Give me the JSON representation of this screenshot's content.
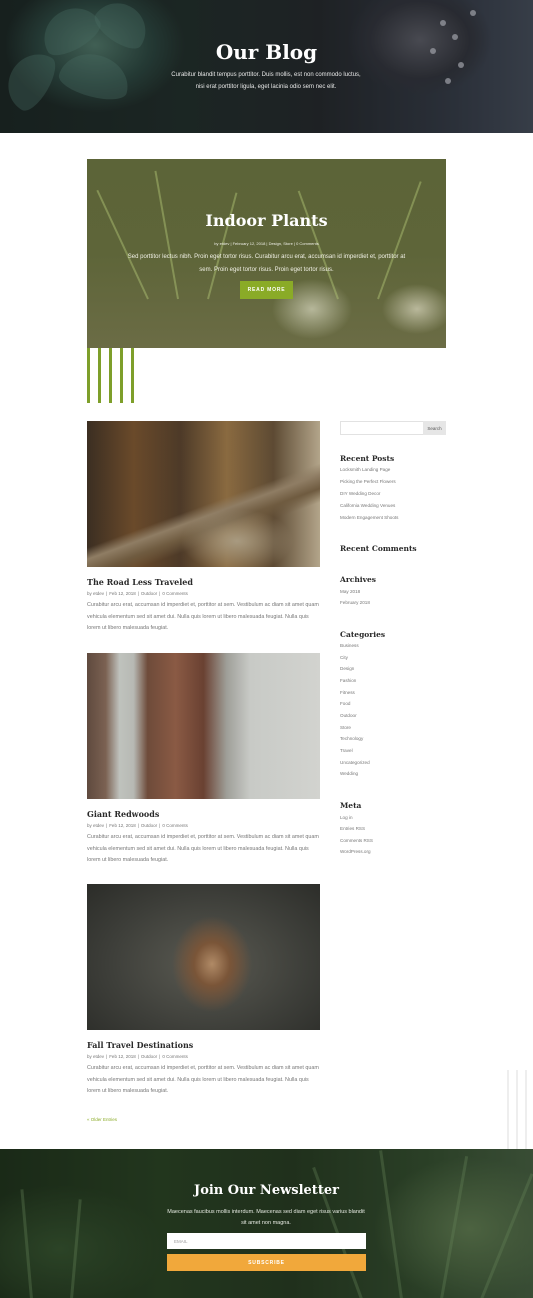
{
  "hero": {
    "title": "Our Blog",
    "subtitle": "Curabitur blandit tempus porttitor. Duis mollis, est non commodo luctus, nisi erat porttitor ligula, eget lacinia odio sem nec elit."
  },
  "featured": {
    "title": "Indoor Plants",
    "meta": "by etdev | February 12, 2018 | Design, Store | 0 Comments",
    "excerpt": "Sed porttitor lectus nibh. Proin eget tortor risus. Curabitur arcu erat, accumsan id imperdiet et, porttitor at sem. Proin eget tortor risus. Proin eget tortor risus.",
    "button_label": "READ MORE"
  },
  "posts": [
    {
      "title": "The Road Less Traveled",
      "author": "by etdev",
      "date": "Feb 12, 2018",
      "category": "Outdoor",
      "comments": "0 Comments",
      "excerpt": "Curabitur arcu erat, accumsan id imperdiet et, porttitor at sem. Vestibulum ac diam sit amet quam vehicula elementum sed sit amet dui. Nulla quis lorem ut libero malesuada feugiat. Nulla quis lorem ut libero malesuada feugiat."
    },
    {
      "title": "Giant Redwoods",
      "author": "by etdev",
      "date": "Feb 12, 2018",
      "category": "Outdoor",
      "comments": "0 Comments",
      "excerpt": "Curabitur arcu erat, accumsan id imperdiet et, porttitor at sem. Vestibulum ac diam sit amet quam vehicula elementum sed sit amet dui. Nulla quis lorem ut libero malesuada feugiat. Nulla quis lorem ut libero malesuada feugiat."
    },
    {
      "title": "Fall Travel Destinations",
      "author": "by etdev",
      "date": "Feb 12, 2018",
      "category": "Outdoor",
      "comments": "0 Comments",
      "excerpt": "Curabitur arcu erat, accumsan id imperdiet et, porttitor at sem. Vestibulum ac diam sit amet quam vehicula elementum sed sit amet dui. Nulla quis lorem ut libero malesuada feugiat. Nulla quis lorem ut libero malesuada feugiat."
    }
  ],
  "pagination": {
    "older_label": "« Older Entries"
  },
  "sidebar": {
    "search": {
      "placeholder": "",
      "button_label": "Search"
    },
    "recent_posts": {
      "title": "Recent Posts",
      "items": [
        "Locksmith Landing Page",
        "Picking the Perfect Flowers",
        "DIY Wedding Decor",
        "California Wedding Venues",
        "Modern Engagement Shoots"
      ]
    },
    "recent_comments": {
      "title": "Recent Comments"
    },
    "archives": {
      "title": "Archives",
      "items": [
        "May 2018",
        "February 2018"
      ]
    },
    "categories": {
      "title": "Categories",
      "items": [
        "Business",
        "City",
        "Design",
        "Fashion",
        "Fitness",
        "Food",
        "Outdoor",
        "Store",
        "Technology",
        "Travel",
        "Uncategorized",
        "Wedding"
      ]
    },
    "meta": {
      "title": "Meta",
      "items": [
        "Log in",
        "Entries RSS",
        "Comments RSS",
        "WordPress.org"
      ]
    }
  },
  "newsletter": {
    "title": "Join Our Newsletter",
    "subtitle": "Maecenas faucibus mollis interdum. Maecenas sed diam eget risus varius blandit sit amet non magna.",
    "email_placeholder": "EMAIL",
    "button_label": "SUBSCRIBE"
  },
  "colors": {
    "accent_green": "#8aab27",
    "stripe_green": "#7e9f2a",
    "subscribe_orange": "#f1a83b"
  }
}
